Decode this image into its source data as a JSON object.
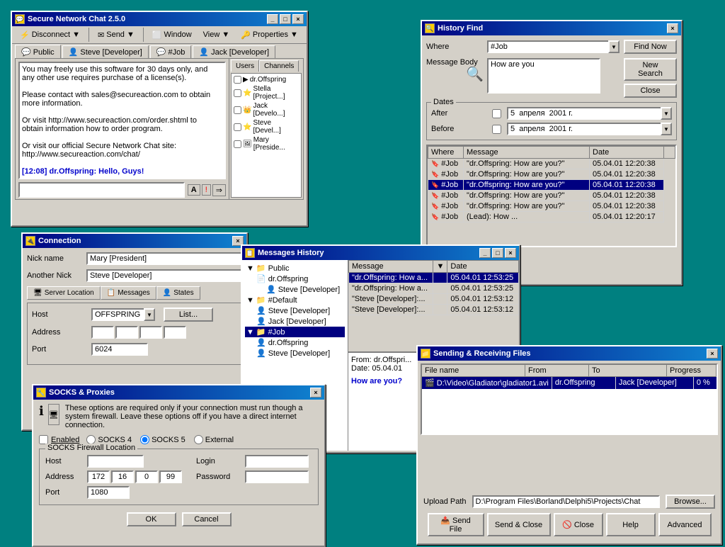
{
  "main_chat": {
    "title": "Secure Network Chat 2.5.0",
    "toolbar": {
      "disconnect": "Disconnect",
      "send": "Send",
      "window": "Window",
      "view": "View",
      "properties": "Properties"
    },
    "tabs": [
      {
        "label": "Public",
        "icon": "💬"
      },
      {
        "label": "Steve [Developer]",
        "icon": "👤"
      },
      {
        "label": "#Job",
        "icon": "💬"
      },
      {
        "label": "Jack [Developer]",
        "icon": "👤"
      }
    ],
    "user_panel_tabs": [
      {
        "label": "Users"
      },
      {
        "label": "Channels"
      }
    ],
    "users": [
      {
        "name": "dr.Offspring"
      },
      {
        "name": "Stella [Project...]"
      },
      {
        "name": "Jack [Develo...]"
      },
      {
        "name": "Steve [Devel...]"
      },
      {
        "name": "Mary [Preside..."
      }
    ],
    "chat_content": [
      "You may freely use this software for 30 days only, and",
      "any other use requires purchase of a license(s).",
      "",
      "Please contact with sales@secureaction.com to obtain",
      "more information.",
      "",
      "Or visit http://www.secureaction.com/order.shtml to",
      "obtain information how to order program.",
      "",
      "Or visit our official Secure Network Chat site:",
      "http://www.secureaction.com/chat/",
      "",
      "[12:08] dr.Offspring: Hello, Guys!"
    ],
    "input_placeholder": ""
  },
  "history_find": {
    "title": "History Find",
    "where_label": "Where",
    "where_value": "#Job",
    "find_now": "Find Now",
    "new_search": "New Search",
    "close": "Close",
    "message_body_label": "Message Body",
    "message_body_value": "How are you",
    "dates_label": "Dates",
    "after_label": "After",
    "after_value": "5  апреля  2001 г.",
    "before_label": "Before",
    "before_value": "5  апреля  2001 г.",
    "table": {
      "headers": [
        "Where",
        "Message",
        "Date"
      ],
      "rows": [
        {
          "where": "#Job",
          "message": "\"dr.Offspring: How are you?\"",
          "date": "05.04.01 12:20:38",
          "selected": false
        },
        {
          "where": "#Job",
          "message": "\"dr.Offspring: How are you?\"",
          "date": "05.04.01 12:20:38",
          "selected": false
        },
        {
          "where": "#Job",
          "message": "\"dr.Offspring: How are you?\"",
          "date": "05.04.01 12:20:38",
          "selected": true
        },
        {
          "where": "#Job",
          "message": "\"dr.Offspring: How are you?\"",
          "date": "05.04.01 12:20:38",
          "selected": false
        },
        {
          "where": "#Job",
          "message": "\"dr.Offspring: How are you?\"",
          "date": "05.04.01 12:20:38",
          "selected": false
        },
        {
          "where": "#Job",
          "message": "(Lead): How ...",
          "date": "05.04.01 12:20:17",
          "selected": false
        }
      ]
    }
  },
  "connection": {
    "title": "Connection",
    "nick_name_label": "Nick name",
    "nick_name_value": "Mary [President]",
    "another_nick_label": "Another Nick",
    "another_nick_value": "Steve [Developer]",
    "tabs": [
      {
        "label": "Server Location",
        "icon": "🖥"
      },
      {
        "label": "Messages",
        "icon": "📋"
      },
      {
        "label": "States",
        "icon": "👤"
      }
    ],
    "host_label": "Host",
    "host_value": "OFFSPRING",
    "list_btn": "List...",
    "address_label": "Address",
    "port_label": "Port",
    "port_value": "6024"
  },
  "messages_history": {
    "title": "Messages History",
    "tree": [
      {
        "label": "Public",
        "children": [
          {
            "label": "dr.Offspring",
            "children": [
              {
                "label": "Steve [Developer]"
              }
            ]
          }
        ]
      },
      {
        "label": "#Default",
        "children": [
          {
            "label": "Steve [Developer]"
          },
          {
            "label": "Jack [Developer]"
          }
        ]
      },
      {
        "label": "#Job",
        "children": [
          {
            "label": "dr.Offspring"
          },
          {
            "label": "Steve [Developer]"
          }
        ]
      }
    ],
    "msg_table": {
      "headers": [
        "Message",
        "Date"
      ],
      "rows": [
        {
          "message": "\"dr.Offspring: How a...",
          "date": "05.04.01 12:53:25",
          "selected": true
        },
        {
          "message": "\"dr.Offspring: How a...",
          "date": "05.04.01 12:53:25",
          "selected": false
        },
        {
          "message": "\"Steve [Developer]:...",
          "date": "05.04.01 12:53:12",
          "selected": false
        },
        {
          "message": "\"Steve [Developer]:...",
          "date": "05.04.01 12:53:12",
          "selected": false
        }
      ]
    },
    "preview": {
      "from": "From: dr.Offspri...",
      "date": "Date: 05.04.01",
      "body": "How are you?"
    }
  },
  "socks": {
    "title": "SOCKS & Proxies",
    "description": "These options are required only if your connection must run though a system firewall. Leave these options off if you have a direct internet connection.",
    "enabled_label": "Enabled",
    "socks4_label": "SOCKS 4",
    "socks5_label": "SOCKS 5",
    "external_label": "External",
    "group_title": "SOCKS Firewall Location",
    "host_label": "Host",
    "address_label": "Address",
    "address_value": "172.16.0.99",
    "login_label": "Login",
    "password_label": "Password",
    "port_label": "Port",
    "port_value": "1080",
    "ok": "OK",
    "cancel": "Cancel"
  },
  "sending_files": {
    "title": "Sending & Receiving Files",
    "table": {
      "headers": [
        "File name",
        "From",
        "To",
        "Progress"
      ],
      "rows": [
        {
          "filename": "D:\\Video\\Gladiator\\gladiator1.avi",
          "from": "dr.Offspring",
          "to": "Jack [Developer]",
          "progress": "0 %"
        }
      ]
    },
    "upload_path_label": "Upload Path",
    "upload_path_value": "D:\\Program Files\\Borland\\Delphi5\\Projects\\Chat",
    "browse_btn": "Browse...",
    "send_file_btn": "Send File",
    "send_close_btn": "Send & Close",
    "close_btn": "Close",
    "help_btn": "Help",
    "advanced_btn": "Advanced"
  }
}
